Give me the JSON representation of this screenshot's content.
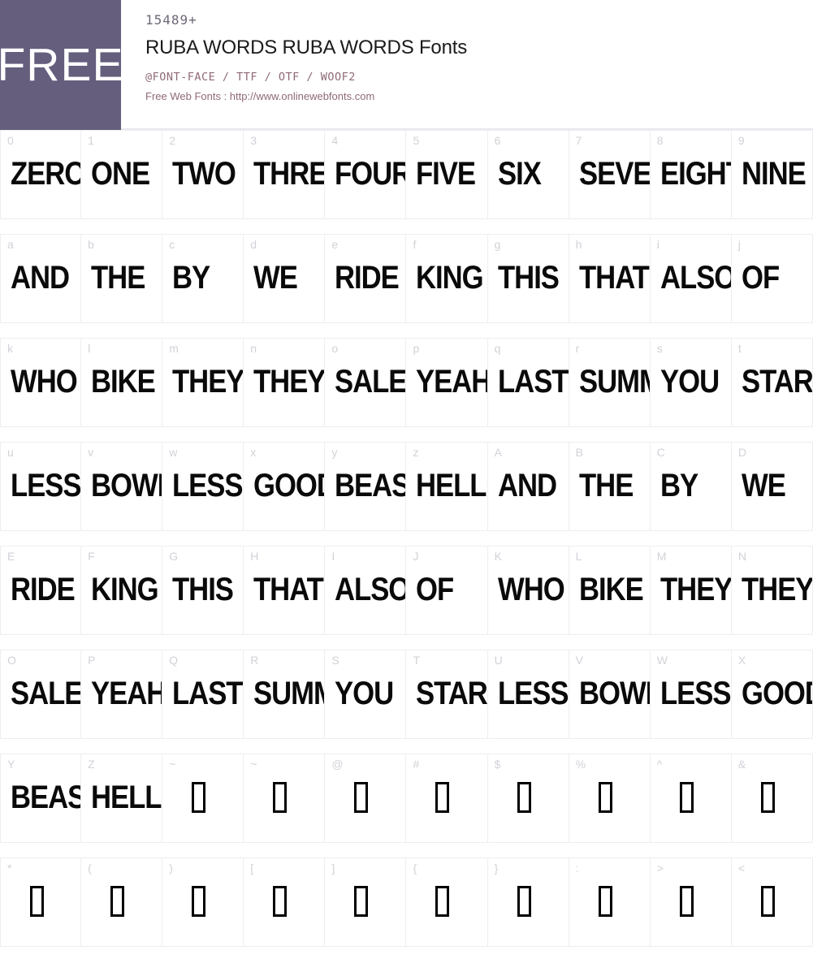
{
  "header": {
    "badge_label": "FREE",
    "count": "15489+",
    "title": "RUBA WORDS RUBA WORDS Fonts",
    "formats": "@FONT-FACE / TTF / OTF / WOOF2",
    "site_line": "Free Web Fonts : http://www.onlinewebfonts.com",
    "badge_color": "#655f7d",
    "accent_color": "#8f6a78",
    "title_color": "#1b1b1b"
  },
  "grid": {
    "rows": [
      {
        "cells": [
          {
            "key": "0",
            "glyph": "ZERO",
            "missing": false
          },
          {
            "key": "1",
            "glyph": "ONE",
            "missing": false
          },
          {
            "key": "2",
            "glyph": "TWO",
            "missing": false
          },
          {
            "key": "3",
            "glyph": "THREE",
            "missing": false
          },
          {
            "key": "4",
            "glyph": "FOUR",
            "missing": false
          },
          {
            "key": "5",
            "glyph": "FIVE",
            "missing": false
          },
          {
            "key": "6",
            "glyph": "SIX",
            "missing": false
          },
          {
            "key": "7",
            "glyph": "SEVEN",
            "missing": false
          },
          {
            "key": "8",
            "glyph": "EIGHT",
            "missing": false
          },
          {
            "key": "9",
            "glyph": "NINE",
            "missing": false
          }
        ]
      },
      {
        "cells": [
          {
            "key": "a",
            "glyph": "AND",
            "missing": false
          },
          {
            "key": "b",
            "glyph": "THE",
            "missing": false
          },
          {
            "key": "c",
            "glyph": "BY",
            "missing": false
          },
          {
            "key": "d",
            "glyph": "WE",
            "missing": false
          },
          {
            "key": "e",
            "glyph": "RIDE",
            "missing": false
          },
          {
            "key": "f",
            "glyph": "KING",
            "missing": false
          },
          {
            "key": "g",
            "glyph": "THIS",
            "missing": false
          },
          {
            "key": "h",
            "glyph": "THAT",
            "missing": false
          },
          {
            "key": "i",
            "glyph": "ALSO",
            "missing": false
          },
          {
            "key": "j",
            "glyph": "OF",
            "missing": false
          }
        ]
      },
      {
        "cells": [
          {
            "key": "k",
            "glyph": "WHO",
            "missing": false
          },
          {
            "key": "l",
            "glyph": "BIKE",
            "missing": false
          },
          {
            "key": "m",
            "glyph": "THEY",
            "missing": false
          },
          {
            "key": "n",
            "glyph": "THEY",
            "missing": false
          },
          {
            "key": "o",
            "glyph": "SALE",
            "missing": false
          },
          {
            "key": "p",
            "glyph": "YEAH",
            "missing": false
          },
          {
            "key": "q",
            "glyph": "LAST",
            "missing": false
          },
          {
            "key": "r",
            "glyph": "SUMMER",
            "missing": false
          },
          {
            "key": "s",
            "glyph": "YOU",
            "missing": false
          },
          {
            "key": "t",
            "glyph": "START",
            "missing": false
          }
        ]
      },
      {
        "cells": [
          {
            "key": "u",
            "glyph": "LESS",
            "missing": false
          },
          {
            "key": "v",
            "glyph": "BOWL",
            "missing": false
          },
          {
            "key": "w",
            "glyph": "LESS",
            "missing": false
          },
          {
            "key": "x",
            "glyph": "GOOD",
            "missing": false
          },
          {
            "key": "y",
            "glyph": "BEAST",
            "missing": false
          },
          {
            "key": "z",
            "glyph": "HELLO",
            "missing": false
          },
          {
            "key": "A",
            "glyph": "AND",
            "missing": false
          },
          {
            "key": "B",
            "glyph": "THE",
            "missing": false
          },
          {
            "key": "C",
            "glyph": "BY",
            "missing": false
          },
          {
            "key": "D",
            "glyph": "WE",
            "missing": false
          }
        ]
      },
      {
        "cells": [
          {
            "key": "E",
            "glyph": "RIDE",
            "missing": false
          },
          {
            "key": "F",
            "glyph": "KING",
            "missing": false
          },
          {
            "key": "G",
            "glyph": "THIS",
            "missing": false
          },
          {
            "key": "H",
            "glyph": "THAT",
            "missing": false
          },
          {
            "key": "I",
            "glyph": "ALSO",
            "missing": false
          },
          {
            "key": "J",
            "glyph": "OF",
            "missing": false
          },
          {
            "key": "K",
            "glyph": "WHO",
            "missing": false
          },
          {
            "key": "L",
            "glyph": "BIKE",
            "missing": false
          },
          {
            "key": "M",
            "glyph": "THEY",
            "missing": false
          },
          {
            "key": "N",
            "glyph": "THEY",
            "missing": false
          }
        ]
      },
      {
        "cells": [
          {
            "key": "O",
            "glyph": "SALE",
            "missing": false
          },
          {
            "key": "P",
            "glyph": "YEAH",
            "missing": false
          },
          {
            "key": "Q",
            "glyph": "LAST",
            "missing": false
          },
          {
            "key": "R",
            "glyph": "SUMMER",
            "missing": false
          },
          {
            "key": "S",
            "glyph": "YOU",
            "missing": false
          },
          {
            "key": "T",
            "glyph": "START",
            "missing": false
          },
          {
            "key": "U",
            "glyph": "LESS",
            "missing": false
          },
          {
            "key": "V",
            "glyph": "BOWL",
            "missing": false
          },
          {
            "key": "W",
            "glyph": "LESS",
            "missing": false
          },
          {
            "key": "X",
            "glyph": "GOOD",
            "missing": false
          }
        ]
      },
      {
        "cells": [
          {
            "key": "Y",
            "glyph": "BEAST",
            "missing": false
          },
          {
            "key": "Z",
            "glyph": "HELLO",
            "missing": false
          },
          {
            "key": "~",
            "glyph": "",
            "missing": true
          },
          {
            "key": "~",
            "glyph": "",
            "missing": true
          },
          {
            "key": "@",
            "glyph": "",
            "missing": true
          },
          {
            "key": "#",
            "glyph": "",
            "missing": true
          },
          {
            "key": "$",
            "glyph": "",
            "missing": true
          },
          {
            "key": "%",
            "glyph": "",
            "missing": true
          },
          {
            "key": "^",
            "glyph": "",
            "missing": true
          },
          {
            "key": "&",
            "glyph": "",
            "missing": true
          }
        ]
      },
      {
        "cells": [
          {
            "key": "*",
            "glyph": "",
            "missing": true
          },
          {
            "key": "(",
            "glyph": "",
            "missing": true
          },
          {
            "key": ")",
            "glyph": "",
            "missing": true
          },
          {
            "key": "[",
            "glyph": "",
            "missing": true
          },
          {
            "key": "]",
            "glyph": "",
            "missing": true
          },
          {
            "key": "{",
            "glyph": "",
            "missing": true
          },
          {
            "key": "}",
            "glyph": "",
            "missing": true
          },
          {
            "key": ":",
            "glyph": "",
            "missing": true
          },
          {
            "key": ">",
            "glyph": "",
            "missing": true
          },
          {
            "key": "<",
            "glyph": "",
            "missing": true
          }
        ]
      }
    ]
  }
}
